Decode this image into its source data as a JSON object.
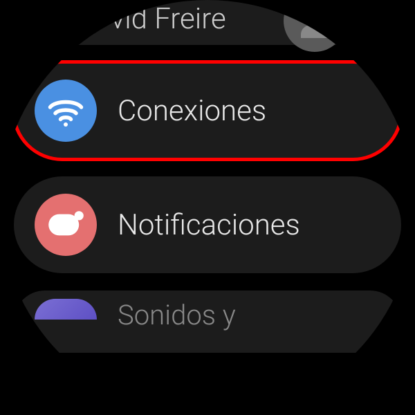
{
  "settings": {
    "profile": {
      "name": "vid Freire"
    },
    "items": [
      {
        "id": "connections",
        "label": "Conexiones",
        "highlighted": true
      },
      {
        "id": "notifications",
        "label": "Notificaciones",
        "highlighted": false
      },
      {
        "id": "sounds",
        "label": "Sonidos y",
        "highlighted": false
      }
    ]
  }
}
